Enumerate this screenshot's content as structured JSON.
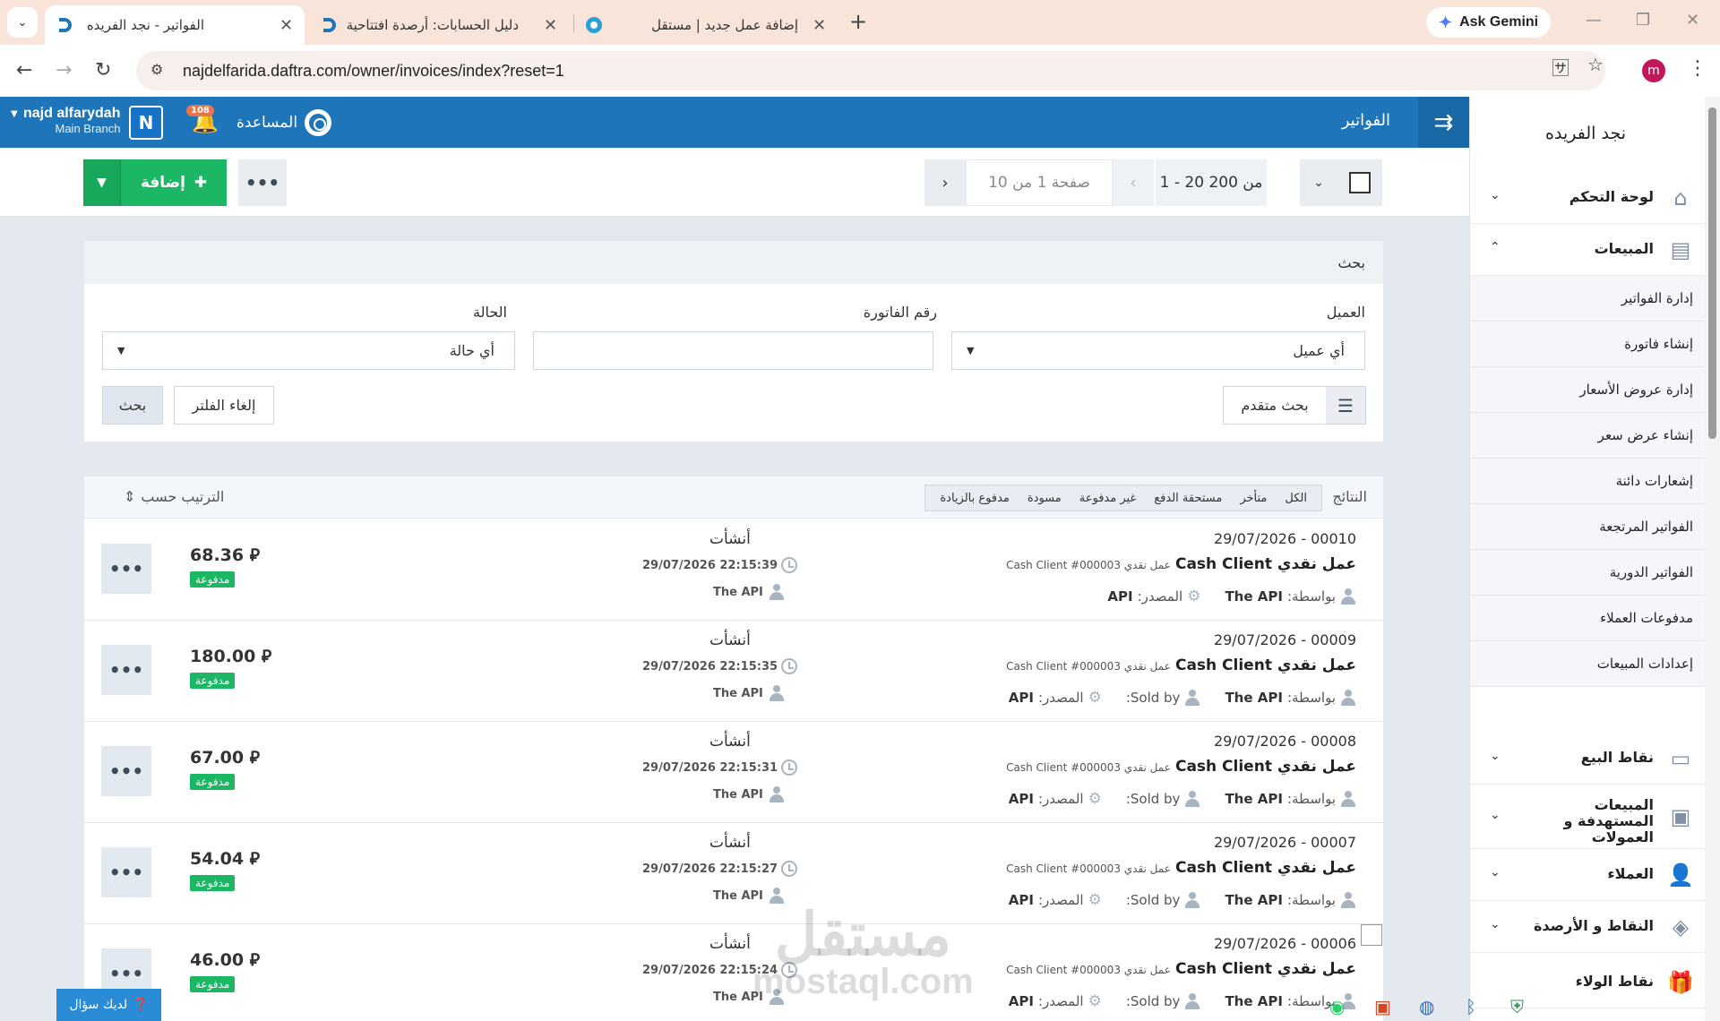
{
  "browser": {
    "tabs": [
      {
        "title": "الفواتير - نجد الفريده",
        "active": true
      },
      {
        "title": "دليل الحسابات: أرصدة افتتاحية",
        "active": false
      },
      {
        "title": "إضافة عمل جديد | مستقل",
        "active": false
      }
    ],
    "gemini_label": "Ask Gemini",
    "url": "najdelfarida.daftra.com/owner/invoices/index?reset=1",
    "profile_initial": "m"
  },
  "topbar": {
    "user_name": "najd alfarydah",
    "user_branch": "Main Branch",
    "avatar_letter": "N",
    "notifications": "108",
    "help_label": "المساعدة",
    "page_title": "الفواتير"
  },
  "toolbar": {
    "add_label": "إضافة",
    "range": "1 - 20 من 200",
    "page": "صفحة 1 من 10"
  },
  "search": {
    "header": "بحث",
    "client_label": "العميل",
    "client_value": "أي عميل",
    "invoice_no_label": "رقم الفاتورة",
    "invoice_no_value": "",
    "status_label": "الحالة",
    "status_value": "أي حالة",
    "advanced_label": "بحث متقدم",
    "clear_label": "إلغاء الفلتر",
    "search_label": "بحث"
  },
  "results": {
    "label": "النتائج",
    "filters": [
      "الكل",
      "متأخر",
      "مستحقة الدفع",
      "غير مدفوعة",
      "مسودة",
      "مدفوع بالزيادة"
    ],
    "sort_label": "الترتيب حسب",
    "rows": [
      {
        "number": "29/07/2026 - 00010",
        "client": "عمل نقدي Cash Client",
        "client_sub": "عمل نقدي Cash Client #000003",
        "by_label": "بواسطة:",
        "by": "The API",
        "sold_by": "",
        "source_label": "المصدر:",
        "source": "API",
        "action": "أنشأت",
        "time": "22:15:39 29/07/2026",
        "actor": "The API",
        "amount": "68.36 ⃁",
        "status": "مدفوعة"
      },
      {
        "number": "29/07/2026 - 00009",
        "client": "عمل نقدي Cash Client",
        "client_sub": "عمل نقدي Cash Client #000003",
        "by_label": "بواسطة:",
        "by": "The API",
        "sold_by": "Sold by:",
        "source_label": "المصدر:",
        "source": "API",
        "action": "أنشأت",
        "time": "22:15:35 29/07/2026",
        "actor": "The API",
        "amount": "180.00 ⃁",
        "status": "مدفوعة"
      },
      {
        "number": "29/07/2026 - 00008",
        "client": "عمل نقدي Cash Client",
        "client_sub": "عمل نقدي Cash Client #000003",
        "by_label": "بواسطة:",
        "by": "The API",
        "sold_by": "Sold by:",
        "source_label": "المصدر:",
        "source": "API",
        "action": "أنشأت",
        "time": "22:15:31 29/07/2026",
        "actor": "The API",
        "amount": "67.00 ⃁",
        "status": "مدفوعة"
      },
      {
        "number": "29/07/2026 - 00007",
        "client": "عمل نقدي Cash Client",
        "client_sub": "عمل نقدي Cash Client #000003",
        "by_label": "بواسطة:",
        "by": "The API",
        "sold_by": "Sold by:",
        "source_label": "المصدر:",
        "source": "API",
        "action": "أنشأت",
        "time": "22:15:27 29/07/2026",
        "actor": "The API",
        "amount": "54.04 ⃁",
        "status": "مدفوعة"
      },
      {
        "number": "29/07/2026 - 00006",
        "client": "عمل نقدي Cash Client",
        "client_sub": "عمل نقدي Cash Client #000003",
        "by_label": "بواسطة:",
        "by": "The API",
        "sold_by": "Sold by:",
        "source_label": "المصدر:",
        "source": "API",
        "action": "أنشأت",
        "time": "22:15:24 29/07/2026",
        "actor": "The API",
        "amount": "46.00 ⃁",
        "status": "مدفوعة"
      }
    ]
  },
  "sidebar": {
    "brand": "نجد الفريده",
    "items": [
      {
        "label": "لوحة التحكم",
        "icon": "home-icon"
      },
      {
        "label": "المبيعات",
        "icon": "sales-icon"
      },
      {
        "label": "نقاط البيع",
        "icon": "pos-icon"
      },
      {
        "label": "المبيعات المستهدفة و العمولات",
        "icon": "commission-icon"
      },
      {
        "label": "العملاء",
        "icon": "clients-icon"
      },
      {
        "label": "النقاط و الأرصدة",
        "icon": "layers-icon"
      },
      {
        "label": "نقاط الولاء",
        "icon": "gift-icon"
      }
    ],
    "sales_sub": [
      "إدارة الفواتير",
      "إنشاء فاتورة",
      "إدارة عروض الأسعار",
      "إنشاء عرض سعر",
      "إشعارات دائنة",
      "الفواتير المرتجعة",
      "الفواتير الدورية",
      "مدفوعات العملاء",
      "إعدادات المبيعات"
    ]
  },
  "watermark": {
    "line1": "مستقل",
    "line2": "mostaql.com"
  },
  "ask_label": "لديك سؤال",
  "colors": {
    "primary": "#1f75b9",
    "success": "#1cb765",
    "background": "#e4e9f0"
  }
}
